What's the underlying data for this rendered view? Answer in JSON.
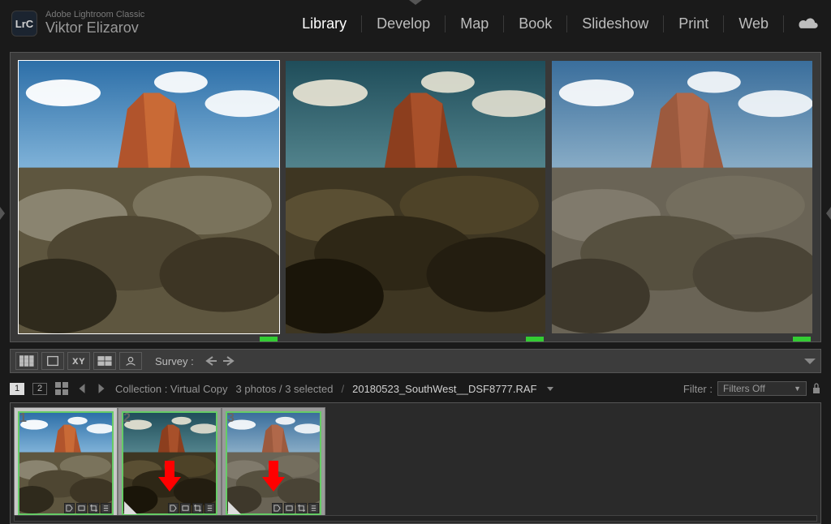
{
  "header": {
    "logo_text": "LrC",
    "app_name": "Adobe Lightroom Classic",
    "user_name": "Viktor Elizarov",
    "modules": [
      "Library",
      "Develop",
      "Map",
      "Book",
      "Slideshow",
      "Print",
      "Web"
    ],
    "active_module": "Library"
  },
  "toolbar": {
    "mode_label": "Survey :"
  },
  "infobar": {
    "sort1": "1",
    "sort2": "2",
    "collection_label": "Collection : Virtual Copy",
    "counts": "3 photos / 3 selected",
    "sep": "/",
    "path": "20180523_SouthWest__DSF8777.RAF",
    "filter_label": "Filter :",
    "filter_value": "Filters Off"
  },
  "filmstrip": {
    "thumbs": [
      {
        "n": "1"
      },
      {
        "n": "2"
      },
      {
        "n": "3"
      }
    ]
  }
}
